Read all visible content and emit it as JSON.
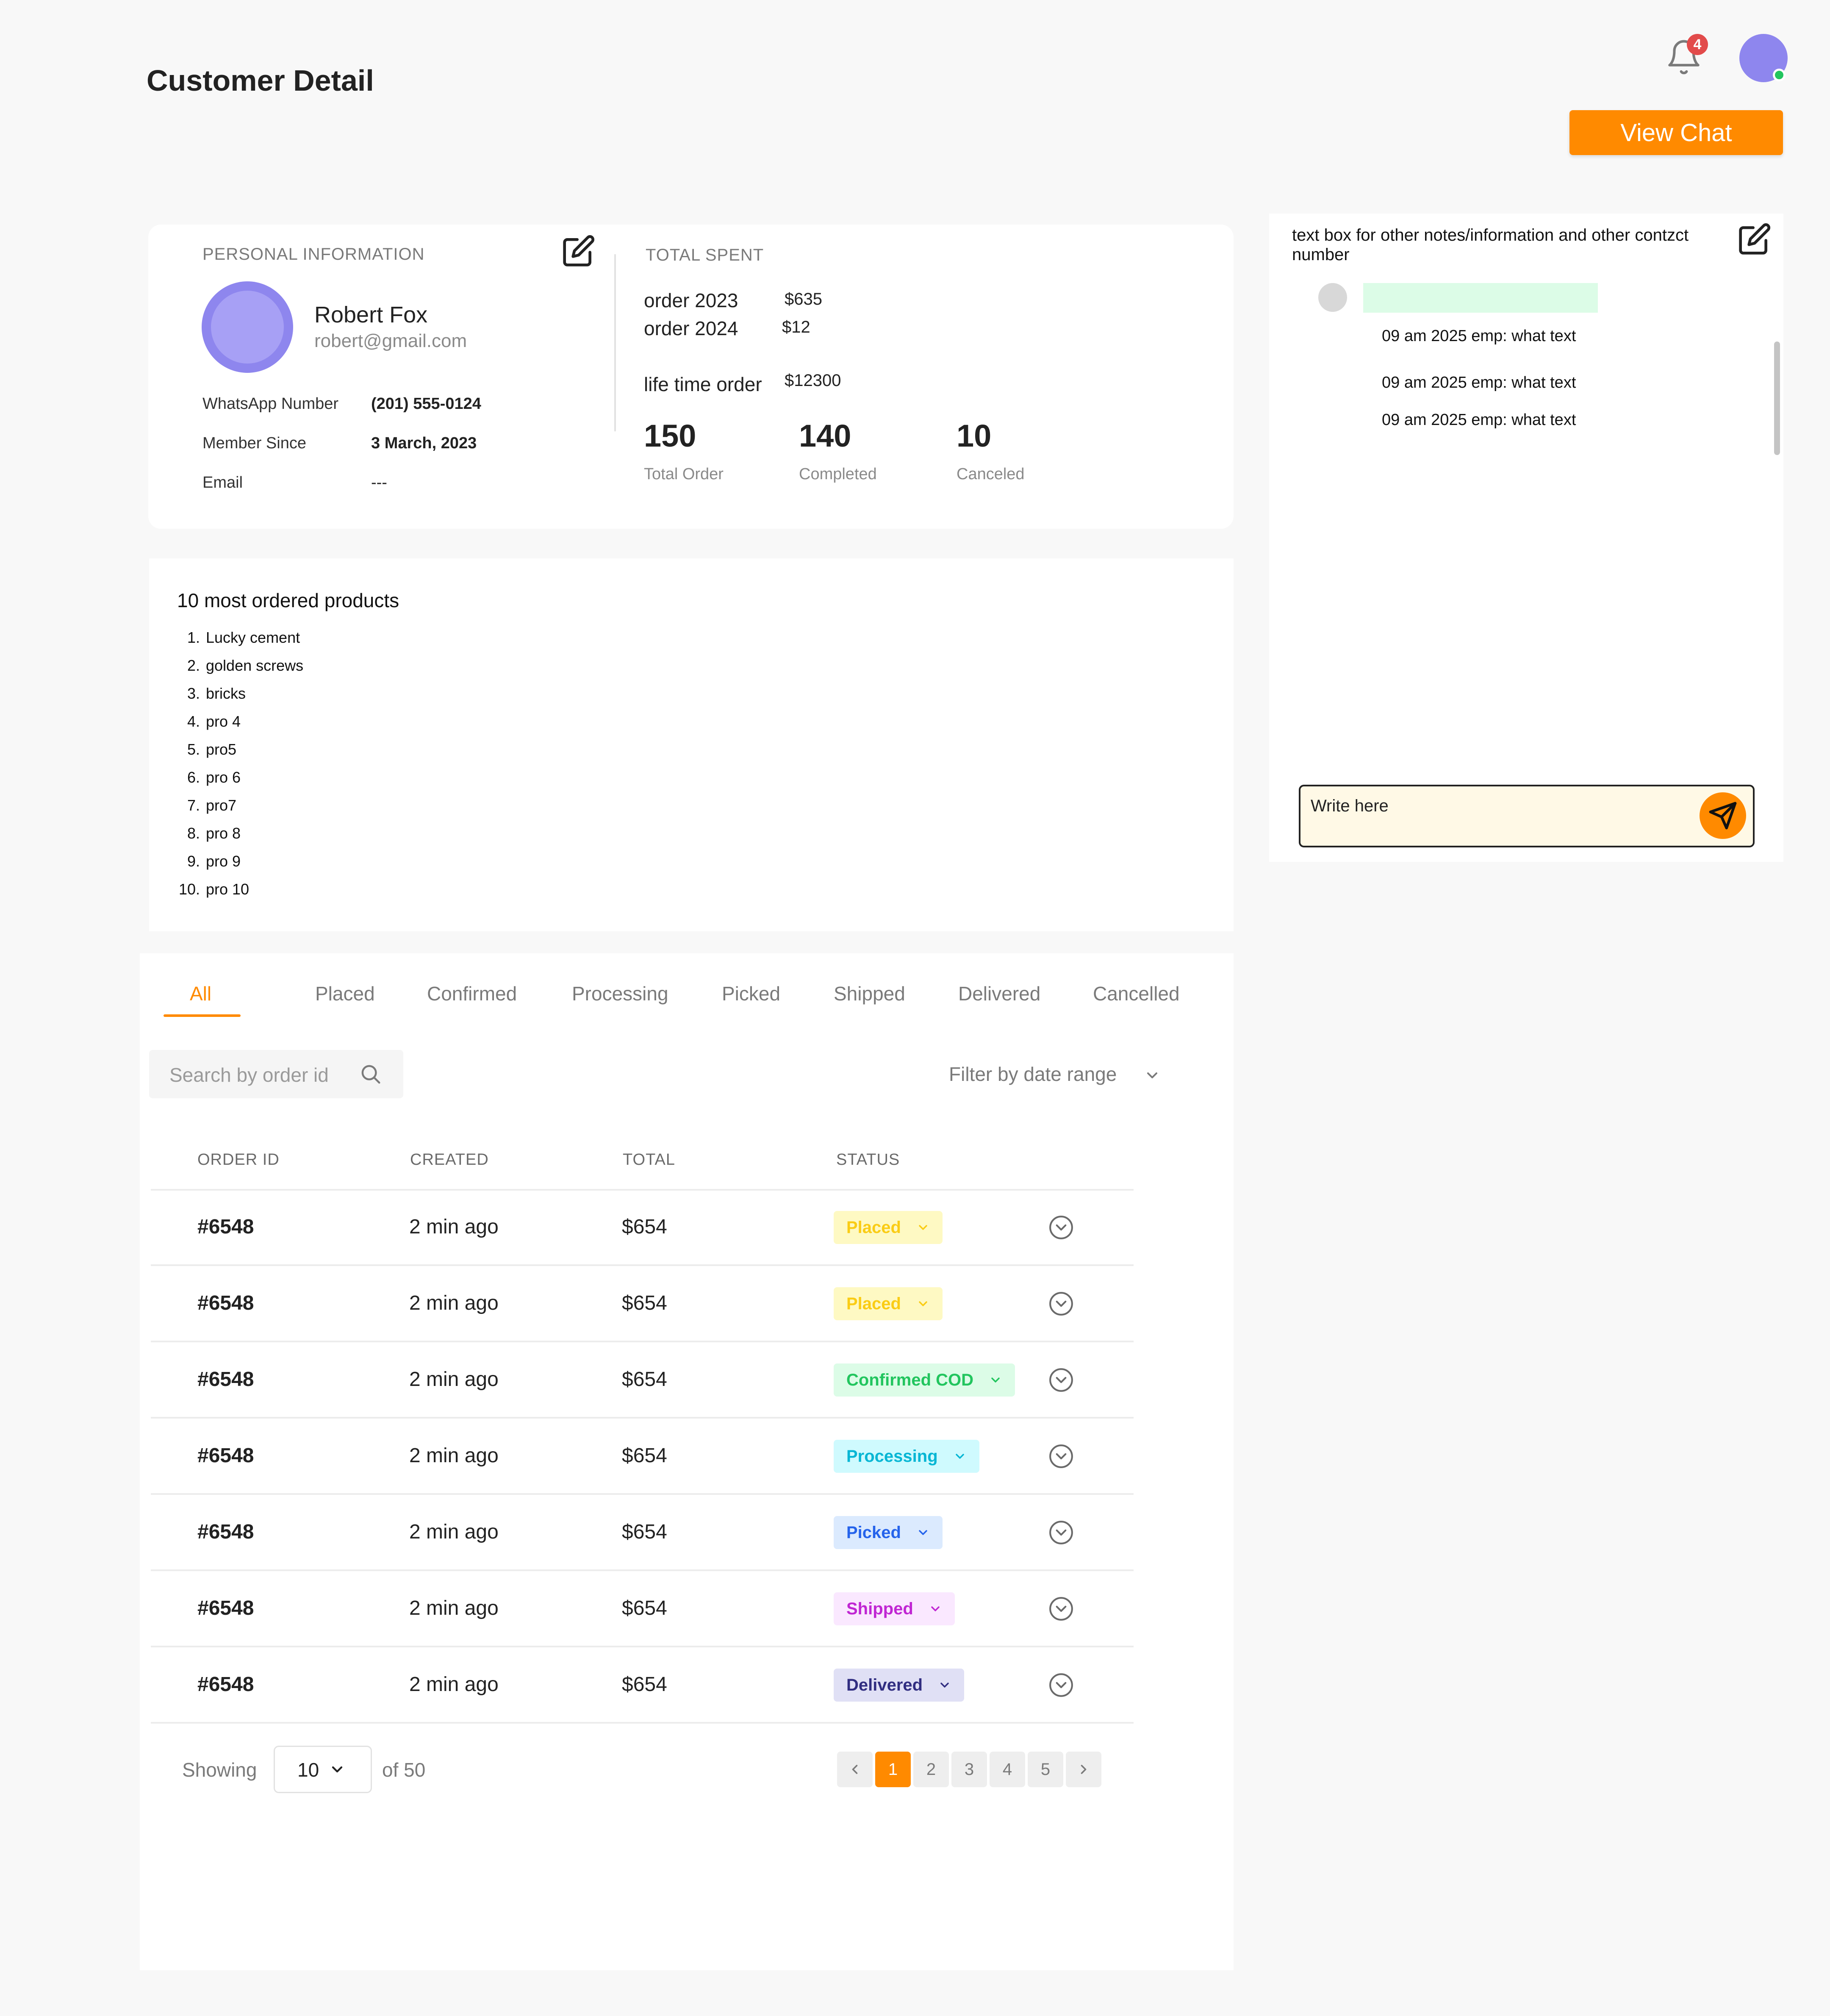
{
  "header": {
    "title": "Customer Detail",
    "notification_count": "4",
    "view_chat_label": "View Chat"
  },
  "personal": {
    "section_label": "PERSONAL INFORMATION",
    "name": "Robert Fox",
    "email": "robert@gmail.com",
    "fields": [
      {
        "key": "WhatsApp Number",
        "value": "(201) 555-0124"
      },
      {
        "key": "Member Since",
        "value": "3 March, 2023"
      },
      {
        "key": "Email",
        "value": "---"
      }
    ]
  },
  "spent": {
    "section_label": "TOTAL SPENT",
    "rows": [
      {
        "label": "order 2023",
        "value": "$635"
      },
      {
        "label": "order 2024",
        "value": "$12"
      }
    ],
    "lifetime_label": "life time order",
    "lifetime_value": "$12300",
    "stats": [
      {
        "value": "150",
        "caption": "Total Order"
      },
      {
        "value": "140",
        "caption": "Completed"
      },
      {
        "value": "10",
        "caption": "Canceled"
      }
    ]
  },
  "notes": {
    "header": "text box for other notes/information and other contzct number",
    "lines": [
      "09 am 2025 emp: what text",
      "09 am 2025 emp: what text",
      "09 am 2025 emp: what text"
    ],
    "input_placeholder": "Write here"
  },
  "products": {
    "title": "10 most ordered products",
    "items": [
      "Lucky cement",
      "golden screws",
      "bricks",
      "pro 4",
      "pro5",
      "pro 6",
      "pro7",
      "pro 8",
      "pro 9",
      "pro 10"
    ],
    "numbers": [
      "1.",
      "2.",
      "3.",
      "4.",
      "5.",
      "6.",
      "7.",
      "8.",
      "9.",
      "10."
    ]
  },
  "orders": {
    "tabs": [
      "All",
      "Placed",
      "Confirmed",
      "Processing",
      "Picked",
      "Shipped",
      "Delivered",
      "Cancelled"
    ],
    "active_tab": "All",
    "search_placeholder": "Search by order id",
    "filter_label": "Filter by date range",
    "columns": [
      "ORDER ID",
      "CREATED",
      "TOTAL",
      "STATUS"
    ],
    "rows": [
      {
        "id": "#6548",
        "created": "2 min ago",
        "total": "$654",
        "status": "Placed"
      },
      {
        "id": "#6548",
        "created": "2 min ago",
        "total": "$654",
        "status": "Placed"
      },
      {
        "id": "#6548",
        "created": "2 min ago",
        "total": "$654",
        "status": "Confirmed COD"
      },
      {
        "id": "#6548",
        "created": "2 min ago",
        "total": "$654",
        "status": "Processing"
      },
      {
        "id": "#6548",
        "created": "2 min ago",
        "total": "$654",
        "status": "Picked"
      },
      {
        "id": "#6548",
        "created": "2 min ago",
        "total": "$654",
        "status": "Shipped"
      },
      {
        "id": "#6548",
        "created": "2 min ago",
        "total": "$654",
        "status": "Delivered"
      }
    ],
    "status_colors": {
      "Placed": {
        "bg": "#fef9c3",
        "fg": "#facc15"
      },
      "Confirmed COD": {
        "bg": "#dcfce7",
        "fg": "#22c55e"
      },
      "Processing": {
        "bg": "#cffafe",
        "fg": "#06b6d4"
      },
      "Picked": {
        "bg": "#dbeafe",
        "fg": "#2563eb"
      },
      "Shipped": {
        "bg": "#fae8ff",
        "fg": "#c026d3"
      },
      "Delivered": {
        "bg": "#e0e0f5",
        "fg": "#312e81"
      }
    }
  },
  "pagination": {
    "showing_label": "Showing",
    "per_page": "10",
    "of_label": "of 50",
    "pages": [
      "1",
      "2",
      "3",
      "4",
      "5"
    ],
    "current_page": "1"
  },
  "colors": {
    "accent": "#ff8a00",
    "avatar": "#8e86ee"
  }
}
